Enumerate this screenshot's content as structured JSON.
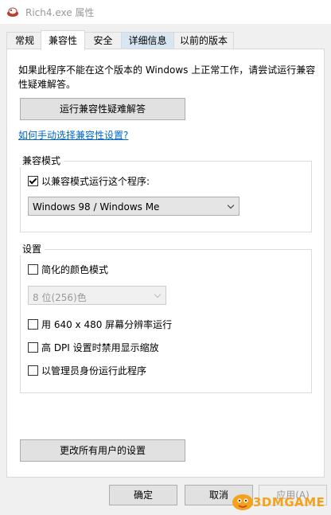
{
  "window": {
    "title": "Rich4.exe 属性"
  },
  "tabs": [
    {
      "label": "常规"
    },
    {
      "label": "兼容性"
    },
    {
      "label": "安全"
    },
    {
      "label": "详细信息"
    },
    {
      "label": "以前的版本"
    }
  ],
  "intro_text": "如果此程序不能在这个版本的 Windows 上正常工作，请尝试运行兼容性疑难解答。",
  "troubleshooter_button": "运行兼容性疑难解答",
  "manual_link": "如何手动选择兼容性设置?",
  "compat_group": {
    "label": "兼容模式",
    "checkbox_label": "以兼容模式运行这个程序:",
    "checked": true,
    "selected_os": "Windows 98 / Windows Me"
  },
  "settings_group": {
    "label": "设置",
    "reduced_color": {
      "label": "简化的颜色模式",
      "checked": false
    },
    "color_select": "8 位(256)色",
    "res_640": {
      "label": "用 640 x 480 屏幕分辨率运行",
      "checked": false
    },
    "high_dpi": {
      "label": "高 DPI 设置时禁用显示缩放",
      "checked": false
    },
    "run_admin": {
      "label": "以管理员身份运行此程序",
      "checked": false
    }
  },
  "all_users_button": "更改所有用户的设置",
  "footer": {
    "ok": "确定",
    "cancel": "取消",
    "apply": "应用(A)"
  },
  "watermark": {
    "text": "3DMGAME"
  },
  "colors": {
    "link": "#0066cc",
    "watermark": "#f4a21b",
    "tab_hover": "#d8e6f2"
  }
}
